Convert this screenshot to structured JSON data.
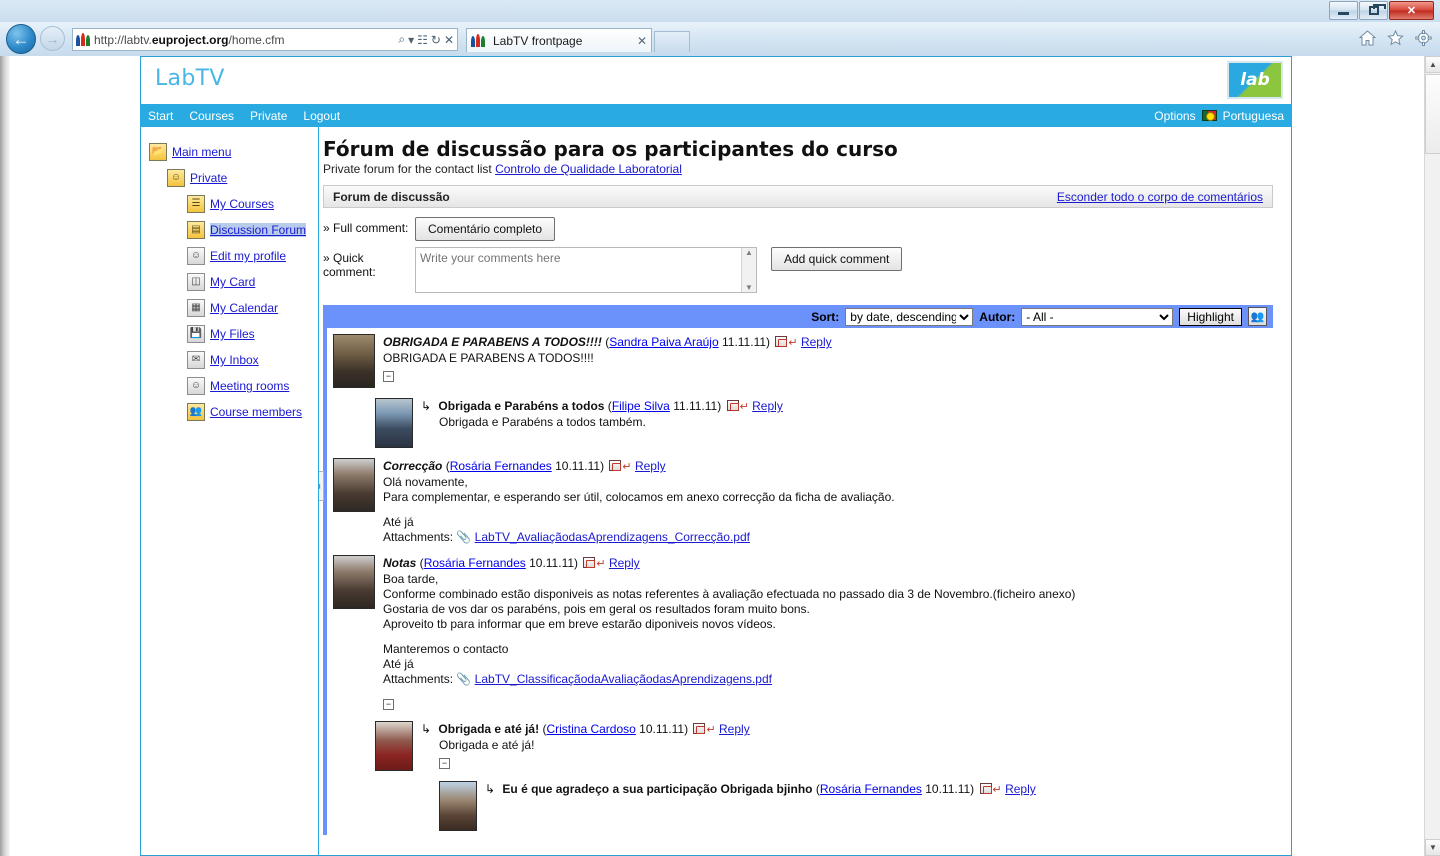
{
  "browser": {
    "url_prefix": "http://labtv.",
    "url_domain": "euproject.org",
    "url_suffix": "/home.cfm",
    "url_full": "http://labtv.euproject.org/home.cfm",
    "tab_title": "LabTV frontpage",
    "tab_close": "✕",
    "search_icon": "⌕",
    "dropdown_icon": "▾",
    "compat_icon": "☷",
    "refresh_icon": "↻",
    "stop_icon": "✕",
    "back_icon": "←",
    "forward_icon": "→",
    "home_icon": "home-icon",
    "favorites_icon": "star-icon",
    "settings_icon": "gear-icon",
    "minimize_label": "–",
    "restore_label": "❐",
    "close_label": "✕"
  },
  "site": {
    "brand": "LabTV",
    "logo_text": "lab",
    "nav": [
      {
        "label": "Start"
      },
      {
        "label": "Courses"
      },
      {
        "label": "Private"
      },
      {
        "label": "Logout"
      }
    ],
    "options_label": "Options",
    "language_label": "Portuguesa"
  },
  "sidebar": {
    "items": [
      {
        "label": "Main menu",
        "level": 1,
        "icon": "folder-open-icon",
        "selected": false
      },
      {
        "label": "Private",
        "level": 2,
        "icon": "folder-user-icon",
        "selected": false
      },
      {
        "label": "My Courses",
        "level": 3,
        "icon": "courses-icon",
        "selected": false
      },
      {
        "label": "Discussion Forum",
        "level": 3,
        "icon": "forum-icon",
        "selected": true
      },
      {
        "label": "Edit my profile",
        "level": 3,
        "icon": "profile-icon",
        "selected": false
      },
      {
        "label": "My Card",
        "level": 3,
        "icon": "card-icon",
        "selected": false
      },
      {
        "label": "My Calendar",
        "level": 3,
        "icon": "calendar-icon",
        "selected": false
      },
      {
        "label": "My Files",
        "level": 3,
        "icon": "floppy-icon",
        "selected": false
      },
      {
        "label": "My Inbox",
        "level": 3,
        "icon": "envelope-icon",
        "selected": false
      },
      {
        "label": "Meeting rooms",
        "level": 3,
        "icon": "meeting-icon",
        "selected": false
      },
      {
        "label": "Course members",
        "level": 3,
        "icon": "members-icon",
        "selected": false
      }
    ]
  },
  "main": {
    "title": "Fórum de discussão para os participantes do curso",
    "subtitle_prefix": "Private forum for the contact list ",
    "subtitle_link": "Controlo de Qualidade Laboratorial",
    "panel_title": "Forum de discussão",
    "hide_all_link": "Esconder todo o corpo de comentários",
    "full_comment_label": "» Full comment:",
    "full_comment_button": "Comentário completo",
    "quick_comment_label": "» Quick comment:",
    "quick_comment_placeholder": "Write your comments here",
    "quick_comment_value": "",
    "add_quick_comment_button": "Add quick comment",
    "sort_label": "Sort:",
    "sort_value": "by date, descending",
    "author_label": "Autor:",
    "author_value": "- All -",
    "highlight_button": "Highlight",
    "reply_label": "Reply",
    "attachments_label": "Attachments:"
  },
  "posts": [
    {
      "title": "OBRIGADA E PARABENS A TODOS!!!!",
      "author": "Sandra Paiva Araújo",
      "date": "11.11.11",
      "body": [
        "OBRIGADA E PARABENS A TODOS!!!!"
      ],
      "avatar": "av1",
      "level": 0,
      "italic": true,
      "collapse": true,
      "attachment": ""
    },
    {
      "title": "Obrigada e Parabéns a todos",
      "author": "Filipe Silva",
      "date": "11.11.11",
      "body": [
        "Obrigada e Parabéns a todos também."
      ],
      "avatar": "av2",
      "level": 1,
      "italic": false,
      "collapse": false,
      "attachment": ""
    },
    {
      "title": "Correcção",
      "author": "Rosária Fernandes",
      "date": "10.11.11",
      "body": [
        "Olá novamente,",
        "Para complementar, e esperando ser útil, colocamos em anexo correcção da ficha de avaliação.",
        "",
        "Até já"
      ],
      "avatar": "av3",
      "level": 0,
      "italic": true,
      "collapse": false,
      "attachment": "LabTV_AvaliaçãodasAprendizagens_Correcção.pdf"
    },
    {
      "title": "Notas",
      "author": "Rosária Fernandes",
      "date": "10.11.11",
      "body": [
        "Boa tarde,",
        "Conforme combinado estão disponiveis as notas referentes à avaliação efectuada no passado dia 3 de Novembro.(ficheiro anexo)",
        "Gostaria de vos dar os parabéns, pois em geral os resultados foram muito bons.",
        "Aproveito tb para informar que em breve estarão diponiveis novos vídeos.",
        "",
        "Manteremos o contacto",
        "Até já"
      ],
      "avatar": "av3",
      "level": 0,
      "italic": true,
      "collapse": true,
      "attachment": "LabTV_ClassificaçãodaAvaliaçãodasAprendizagens.pdf"
    },
    {
      "title": "Obrigada e até já!",
      "author": "Cristina Cardoso",
      "date": "10.11.11",
      "body": [
        "Obrigada e até já!"
      ],
      "avatar": "av4",
      "level": 1,
      "italic": false,
      "collapse": true,
      "attachment": ""
    },
    {
      "title": "Eu é que agradeço a sua participação Obrigada bjinho",
      "author": "Rosária Fernandes",
      "date": "10.11.11",
      "body": [],
      "avatar": "av5",
      "level": 2,
      "italic": false,
      "collapse": false,
      "attachment": ""
    }
  ],
  "colors": {
    "nav_blue": "#29abe2",
    "toolbar_blue": "#6b91fa",
    "link_blue": "#1a1ad0",
    "selection": "#b6ccea"
  }
}
